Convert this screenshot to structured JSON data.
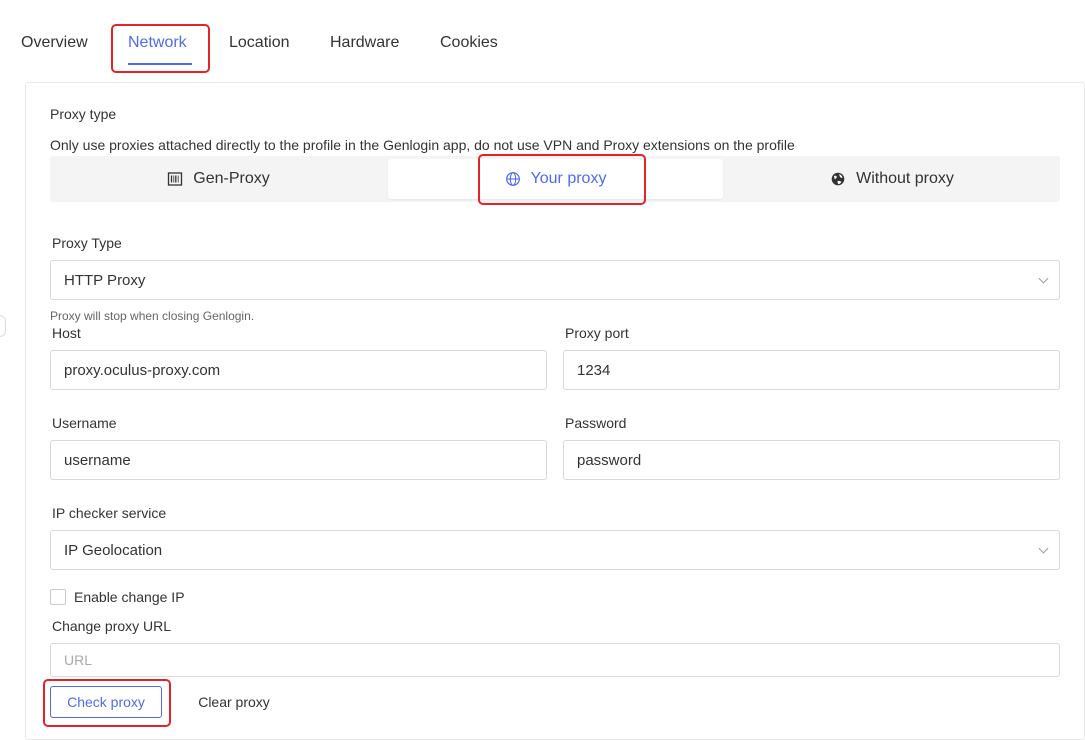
{
  "tabs": [
    {
      "label": "Overview"
    },
    {
      "label": "Network"
    },
    {
      "label": "Location"
    },
    {
      "label": "Hardware"
    },
    {
      "label": "Cookies"
    }
  ],
  "active_tab": "Network",
  "proxy_section": {
    "title": "Proxy type",
    "notice": "Only use proxies attached directly to the profile in the Genlogin app, do not use VPN and Proxy extensions on the profile",
    "options": [
      {
        "label": "Gen-Proxy",
        "icon": "barcode-icon"
      },
      {
        "label": "Your proxy",
        "icon": "globe-icon"
      },
      {
        "label": "Without proxy",
        "icon": "globe-filled-icon"
      }
    ],
    "selected": "Your proxy"
  },
  "form": {
    "proxy_type_label": "Proxy Type",
    "proxy_type_value": "HTTP Proxy",
    "proxy_note": "Proxy will stop when closing Genlogin.",
    "host_label": "Host",
    "host_value": "proxy.oculus-proxy.com",
    "port_label": "Proxy port",
    "port_value": "1234",
    "username_label": "Username",
    "username_value": "username",
    "password_label": "Password",
    "password_value": "password",
    "ip_checker_label": "IP checker service",
    "ip_checker_value": "IP Geolocation",
    "enable_change_ip_label": "Enable change IP",
    "change_url_label": "Change proxy URL",
    "change_url_placeholder": "URL"
  },
  "actions": {
    "check_label": "Check proxy",
    "clear_label": "Clear proxy"
  },
  "colors": {
    "accent": "#4f6bed",
    "highlight": "#e5222a"
  }
}
